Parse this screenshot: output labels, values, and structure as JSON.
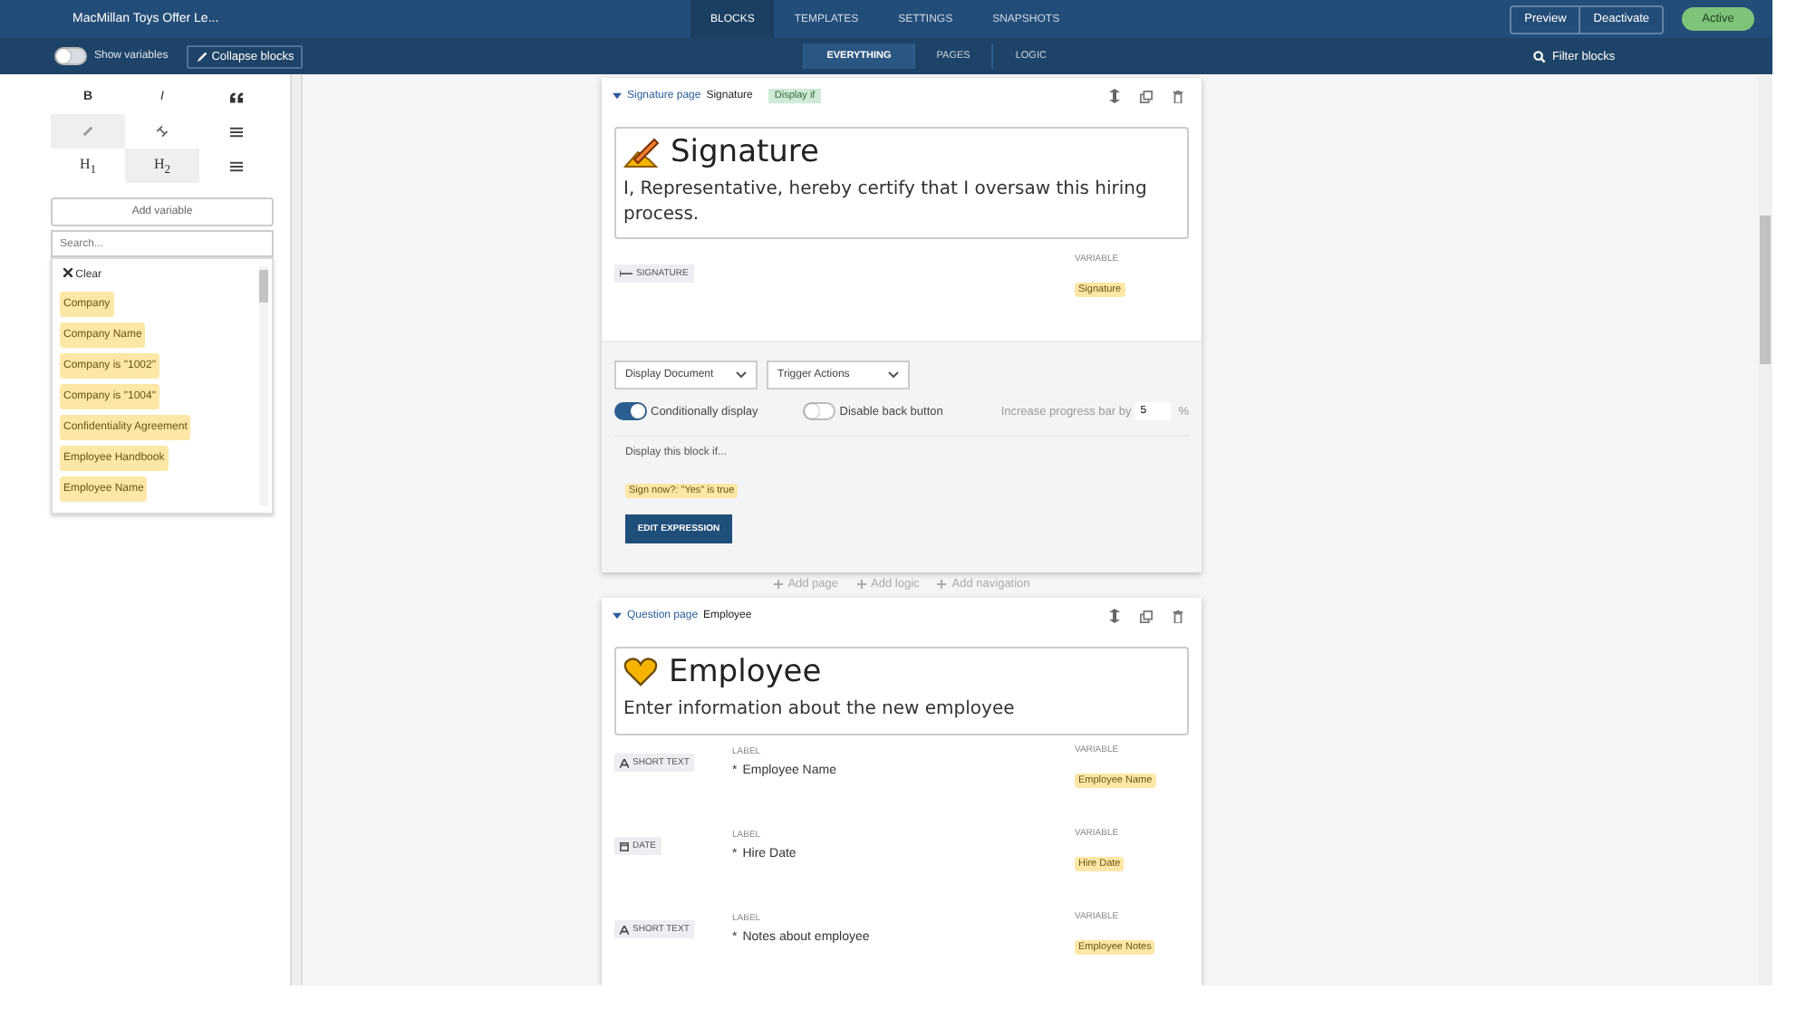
{
  "header": {
    "title": "MacMillan Toys Offer Le...",
    "tabs": [
      {
        "label": "BLOCKS",
        "selected": true
      },
      {
        "label": "TEMPLATES",
        "selected": false
      },
      {
        "label": "SETTINGS",
        "selected": false
      },
      {
        "label": "SNAPSHOTS",
        "selected": false
      }
    ],
    "buttons": [
      "Preview",
      "Deactivate"
    ],
    "status": {
      "label": "Active",
      "on": true
    }
  },
  "subbar": {
    "show_variables": {
      "label": "Show variables",
      "on": false
    },
    "collapse_button": "Collapse blocks",
    "view_tabs": [
      {
        "label": "EVERYTHING",
        "selected": true
      },
      {
        "label": "PAGES",
        "selected": false
      },
      {
        "label": "LOGIC",
        "selected": false
      }
    ],
    "filter": "Filter blocks"
  },
  "format_toolbar": [
    {
      "kind": "bold",
      "label": "B",
      "selected": false
    },
    {
      "kind": "italic",
      "label": "I",
      "selected": false
    },
    {
      "kind": "quote",
      "selected": false
    },
    {
      "kind": "link",
      "selected": true
    },
    {
      "kind": "unlink",
      "selected": false
    },
    {
      "kind": "list",
      "selected": false
    },
    {
      "kind": "heading",
      "label": "H$_{1}$",
      "selected": false
    },
    {
      "kind": "heading",
      "label": "H$_{2}$",
      "selected": true
    },
    {
      "kind": "list",
      "selected": false
    }
  ],
  "add_variable": "Add variable",
  "variable_search": {
    "placeholder": "Search..."
  },
  "clear": "Clear",
  "variables": [
    "Company",
    "Company Name",
    "Company is \"1002\"",
    "Company is \"1004\"",
    "Confidentiality Agreement",
    "Employee Handbook",
    "Employee Name"
  ],
  "blocks": [
    {
      "kind": "signature",
      "type_label": "Signature page",
      "name": "Signature",
      "badge": "Display if",
      "title": "Signature",
      "description": "I, Representative, hereby certify that I oversaw this hiring process.",
      "fields": [
        {
          "kind": "signature",
          "type_label": "SIGNATURE",
          "variable_heading": "VARIABLE",
          "variable": "Signature"
        }
      ],
      "settings": {
        "dropdowns": [
          "Display Document",
          "Trigger Actions"
        ],
        "toggles": [
          {
            "label": "Conditionally display",
            "on": true
          },
          {
            "label": "Disable back button",
            "on": false
          }
        ],
        "progress": {
          "label": "Increase progress bar by",
          "value": "5",
          "unit": "%"
        },
        "condition": {
          "heading": "Display this block if...",
          "expression": "Sign now?: \"Yes\" is true",
          "button": "EDIT EXPRESSION"
        }
      }
    },
    {
      "kind": "question",
      "type_label": "Question page",
      "name": "Employee",
      "title": "Employee",
      "description": "Enter information about the new employee",
      "fields": [
        {
          "kind": "short_text",
          "type_label": "SHORT TEXT",
          "label_heading": "LABEL",
          "required_mark": "*",
          "label": "Employee Name",
          "variable_heading": "VARIABLE",
          "variable": "Employee Name"
        },
        {
          "kind": "date",
          "type_label": "DATE",
          "label_heading": "LABEL",
          "required_mark": "*",
          "label": "Hire Date",
          "variable_heading": "VARIABLE",
          "variable": "Hire Date"
        },
        {
          "kind": "short_text",
          "type_label": "SHORT TEXT",
          "label_heading": "LABEL",
          "required_mark": "*",
          "label": "Notes about employee",
          "variable_heading": "VARIABLE",
          "variable": "Employee Notes"
        }
      ]
    }
  ],
  "add_links": [
    "Add page",
    "Add logic",
    "Add navigation"
  ]
}
